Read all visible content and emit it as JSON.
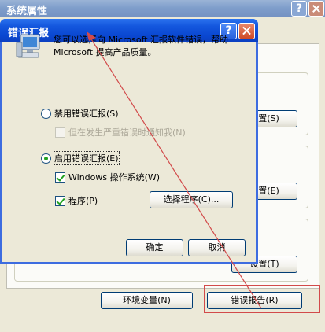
{
  "background_window": {
    "title": "系统属性",
    "help_glyph": "?",
    "buttons": {
      "settings_1": "设置(S)",
      "settings_2": "设置(E)",
      "settings_3": "设置(T)",
      "environment_variables": "环境变量(N)",
      "error_reporting": "错误报告(R)"
    }
  },
  "dialog": {
    "title": "错误汇报",
    "help_glyph": "?",
    "intro_text": "您可以选择向 Microsoft 汇报软件错误，帮助 Microsoft 提高产品质量。",
    "disable_option": "禁用错误汇报(S)",
    "notify_critical_option": "但在发生严重错误时通知我(N)",
    "enable_option": "启用错误汇报(E)",
    "windows_os_option": "Windows 操作系统(W)",
    "programs_option": "程序(P)",
    "choose_programs_button": "选择程序(C)...",
    "ok_button": "确定",
    "cancel_button": "取消",
    "state": {
      "disable_selected": false,
      "notify_critical_checked": false,
      "enable_selected": true,
      "windows_os_checked": true,
      "programs_checked": true
    }
  },
  "annotation": {
    "arrow_color": "#d24a4a",
    "highlight_color": "#d24a4a"
  },
  "colors": {
    "dialog_titlebar": "#0a48d2",
    "window_face": "#ece9d8",
    "inactive_titlebar": "#7f9ecb"
  }
}
